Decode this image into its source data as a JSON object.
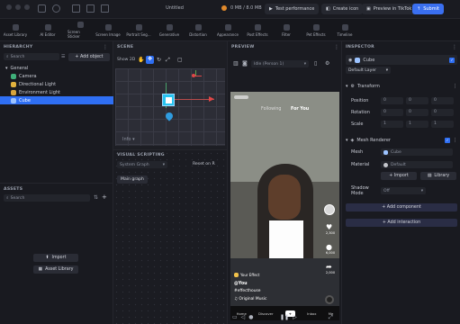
{
  "window": {
    "title": "Untitled",
    "memory": "0 MB / 8.0 MB"
  },
  "header": {
    "test_performance": "Test performance",
    "create_icon": "Create icon",
    "preview_tiktok": "Preview in TikTok",
    "submit": "Submit"
  },
  "toolbar": [
    "Asset Library",
    "AI Editor",
    "Screen Sticker",
    "Screen Image",
    "Portrait Seg...",
    "Generative",
    "Distortion",
    "Appearance",
    "Post Effects",
    "Filter",
    "Pet Effects",
    "Timeline"
  ],
  "hierarchy": {
    "title": "HIERARCHY",
    "search_placeholder": "Search",
    "add_object": "+ Add object",
    "items": [
      {
        "label": "General",
        "type": "group"
      },
      {
        "label": "Camera",
        "type": "item"
      },
      {
        "label": "Directional Light",
        "type": "item"
      },
      {
        "label": "Environment Light",
        "type": "item"
      },
      {
        "label": "Cube",
        "type": "item",
        "selected": true
      }
    ]
  },
  "assets": {
    "title": "ASSETS",
    "search_placeholder": "Search",
    "import": "Import",
    "asset_library": "Asset Library"
  },
  "scene": {
    "title": "SCENE",
    "show2d": "Show 2D",
    "info": "Info"
  },
  "visual_scripting": {
    "title": "VISUAL SCRIPTING",
    "graph_select": "System Graph",
    "reset": "Reset on R",
    "main_graph": "Main graph"
  },
  "preview": {
    "title": "PREVIEW",
    "mode": "Idle (Person 1)",
    "tabs": [
      "Following",
      "For You"
    ],
    "effect_label": "Your Effect",
    "caption_user": "@You",
    "caption_tag": "#effecthouse",
    "music": "Original Music",
    "nav": [
      "Home",
      "Discover",
      "+",
      "Inbox",
      "Me"
    ],
    "side_counts": [
      "2,300",
      "6,000",
      "2,000"
    ]
  },
  "inspector": {
    "title": "INSPECTOR",
    "object_name": "Cube",
    "layer": "Default Layer",
    "transform": {
      "title": "Transform",
      "rows": [
        {
          "label": "Position",
          "values": [
            "0",
            "0",
            "0"
          ]
        },
        {
          "label": "Rotation",
          "values": [
            "0",
            "0",
            "0"
          ]
        },
        {
          "label": "Scale",
          "values": [
            "1",
            "1",
            "1"
          ]
        }
      ]
    },
    "mesh_renderer": {
      "title": "Mesh Renderer",
      "mesh_label": "Mesh",
      "mesh_value": "Cube",
      "material_label": "Material",
      "material_value": "Default",
      "import": "+ Import",
      "library": "Library",
      "shadow_label": "Shadow Mode",
      "shadow_value": "Off"
    },
    "add_component": "+ Add component",
    "add_interaction": "+ Add interaction"
  },
  "colors": {
    "accent": "#2f6ff3",
    "background": "#111217",
    "panel": "#191a20"
  }
}
